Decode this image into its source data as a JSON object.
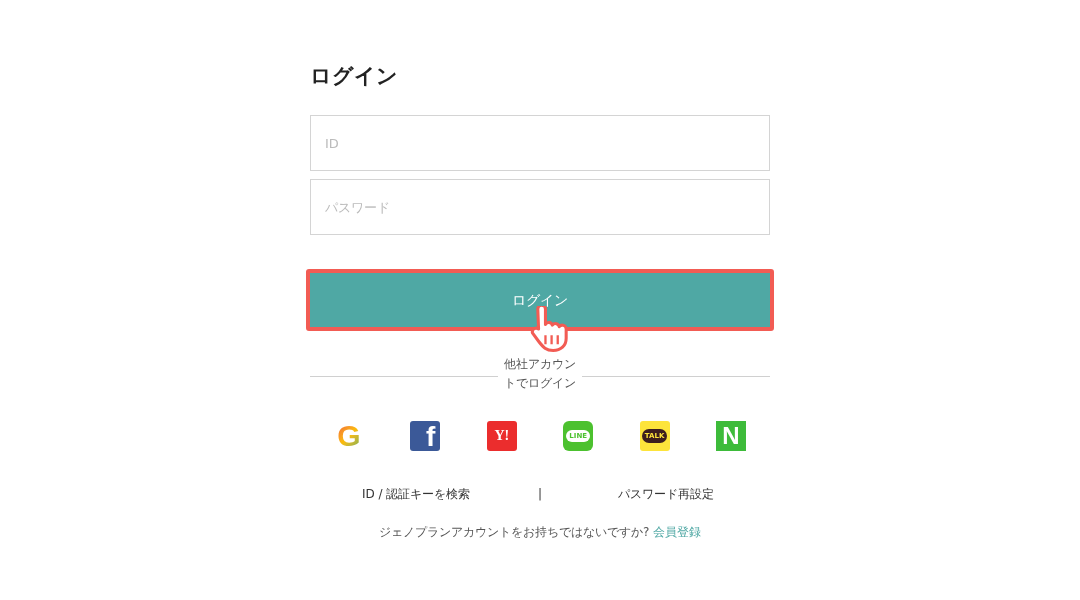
{
  "title": "ログイン",
  "fields": [
    {
      "placeholder": "ID"
    },
    {
      "placeholder": "パスワード"
    }
  ],
  "login_button": {
    "label": "ログイン",
    "highlighted": true
  },
  "divider_label": "他社アカウントでログイン",
  "social": [
    {
      "kind": "google",
      "text": "G"
    },
    {
      "kind": "facebook",
      "text": "f"
    },
    {
      "kind": "yahoo",
      "text": "Y!"
    },
    {
      "kind": "line",
      "text": "LINE"
    },
    {
      "kind": "kakao",
      "text": "TALK"
    },
    {
      "kind": "naver",
      "text": "N"
    }
  ],
  "links": [
    {
      "label": "ID / 認証キーを検索"
    },
    {
      "label": "|"
    },
    {
      "label": "パスワード再設定"
    }
  ],
  "signup": {
    "prompt": "ジェノプランアカウントをお持ちではないですか?",
    "link": "会員登録"
  }
}
